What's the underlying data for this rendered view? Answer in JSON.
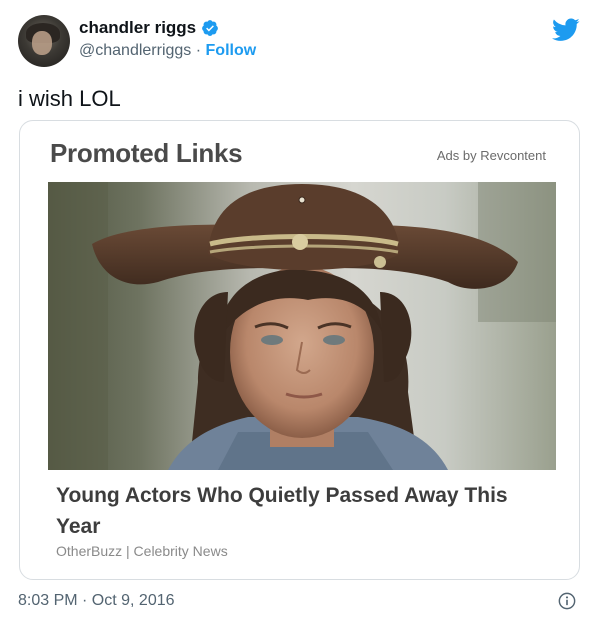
{
  "tweet": {
    "author_name": "chandler riggs",
    "handle": "@chandlerriggs",
    "separator": " · ",
    "follow_label": "Follow",
    "text": "i wish LOL",
    "timestamp": "8:03 PM · Oct 9, 2016"
  },
  "card": {
    "heading": "Promoted Links",
    "ads_by": "Ads by Revcontent",
    "article_title": "Young Actors Who Quietly Passed Away This Year",
    "source": "OtherBuzz | Celebrity News"
  },
  "icons": [
    "verified-badge-icon",
    "twitter-bird-icon",
    "info-icon"
  ],
  "colors": {
    "accent": "#1d9bf0",
    "text": "#0f1419",
    "muted": "#536471"
  }
}
